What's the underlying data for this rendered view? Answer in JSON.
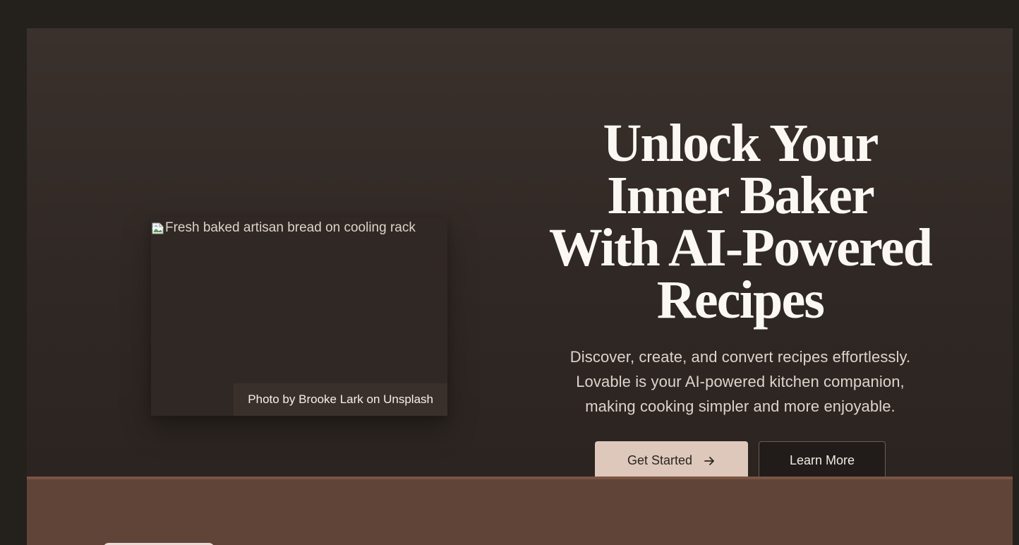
{
  "hero": {
    "image_alt": "Fresh baked artisan bread on cooling rack",
    "credit": "Photo by Brooke Lark on Unsplash",
    "title_lines": [
      "Unlock Your",
      "Inner Baker",
      "With AI-Powered",
      "Recipes"
    ],
    "subtitle_lines": [
      "Discover, create, and convert recipes effortlessly.",
      "Lovable is your AI-powered kitchen companion,",
      "making cooking simpler and more enjoyable."
    ],
    "buttons": {
      "primary": "Get Started",
      "secondary": "Learn More"
    }
  },
  "icons": {
    "broken_image": "broken-image-icon",
    "arrow_right": "arrow-right-icon"
  },
  "colors": {
    "page_bg": "#24201c",
    "hero_bg": "#302824",
    "primary_button": "#ddc8bb",
    "secondary_button": "#211c19",
    "lower_section": "#604437",
    "lower_section_border": "#7a5443"
  }
}
